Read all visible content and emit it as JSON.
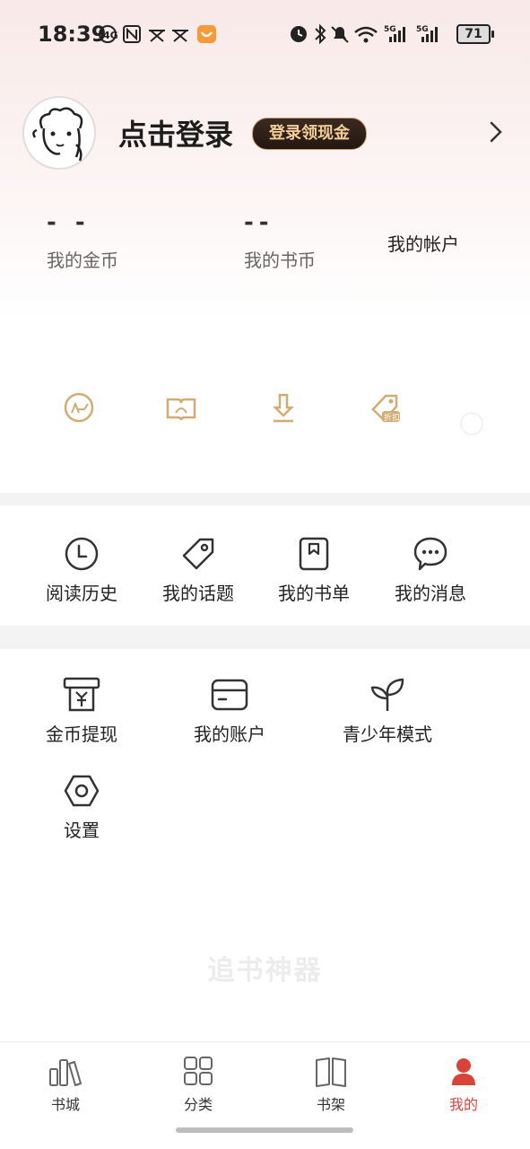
{
  "status_bar": {
    "time": "18:39",
    "left_icons": [
      "nfc-icon",
      "notification-icon",
      "notification-icon",
      "app-icon"
    ],
    "right_icons": [
      "alarm-icon",
      "bluetooth-icon",
      "mute-icon",
      "wifi-icon",
      "signal-5g-icon",
      "signal-5g-icon"
    ],
    "battery": "71"
  },
  "profile": {
    "login_title": "点击登录",
    "login_badge": "登录领现金"
  },
  "stats": {
    "coins_value": "- -",
    "coins_label": "我的金币",
    "book_coins_value": "--",
    "book_coins_label": "我的书币",
    "account_link": "我的帐户"
  },
  "quick_icons": [
    "vip-card-icon",
    "read-book-icon",
    "download-icon",
    "discount-tag-icon",
    "placeholder-circle-icon"
  ],
  "menu_row": [
    {
      "label": "阅读历史",
      "icon": "clock-icon"
    },
    {
      "label": "我的话题",
      "icon": "tag-icon"
    },
    {
      "label": "我的书单",
      "icon": "bookmark-list-icon"
    },
    {
      "label": "我的消息",
      "icon": "chat-bubble-icon"
    }
  ],
  "menu_grid": [
    {
      "label": "金币提现",
      "icon": "withdraw-icon"
    },
    {
      "label": "我的账户",
      "icon": "card-icon"
    },
    {
      "label": "青少年模式",
      "icon": "sprout-icon"
    },
    {
      "label": "设置",
      "icon": "settings-hex-icon"
    }
  ],
  "watermark": "追书神器",
  "tabbar": [
    {
      "label": "书城",
      "icon": "bookstore-icon",
      "active": false
    },
    {
      "label": "分类",
      "icon": "grid-icon",
      "active": false
    },
    {
      "label": "书架",
      "icon": "bookshelf-icon",
      "active": false
    },
    {
      "label": "我的",
      "icon": "profile-icon",
      "active": true
    }
  ],
  "colors": {
    "accent": "#d9443a",
    "gold": "#c9a062",
    "badge_bg": "#2b1c15",
    "badge_text": "#f2cd98"
  }
}
